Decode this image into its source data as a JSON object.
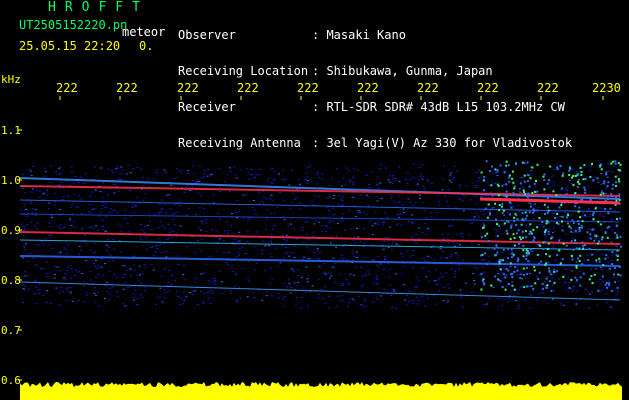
{
  "header": {
    "app_title": "HROFFT",
    "file_name": "UT2505152220.pn",
    "type_label": "meteor",
    "timestamp": "25.05.15 22:20",
    "frame_marker": "0."
  },
  "station_info": [
    {
      "label": "Observer",
      "value": ": Masaki Kano"
    },
    {
      "label": "Receiving Location",
      "value": ": Shibukawa, Gunma, Japan"
    },
    {
      "label": "Receiver",
      "value": ": RTL-SDR SDR# 43dB L15 103.2MHz CW"
    },
    {
      "label": "Receiving Antenna",
      "value": ": 3el Yagi(V) Az 330 for Vladivostok"
    }
  ],
  "axis": {
    "unit_label": "kHz",
    "time_ticks": [
      "222",
      "222",
      "222",
      "222",
      "222",
      "222",
      "222",
      "222",
      "222",
      "2230"
    ],
    "freq_ticks": [
      "1.1",
      "1.0",
      "0.9",
      "0.8",
      "0.7",
      "0.6"
    ]
  },
  "colors": {
    "title_green": "#00ff66",
    "text_white": "#ffffff",
    "tick_yellow": "#ffff00",
    "background": "#000000",
    "spectrum_blue": "#1020c8",
    "signal_red": "#ff3050",
    "signal_green": "#40ff60"
  }
}
